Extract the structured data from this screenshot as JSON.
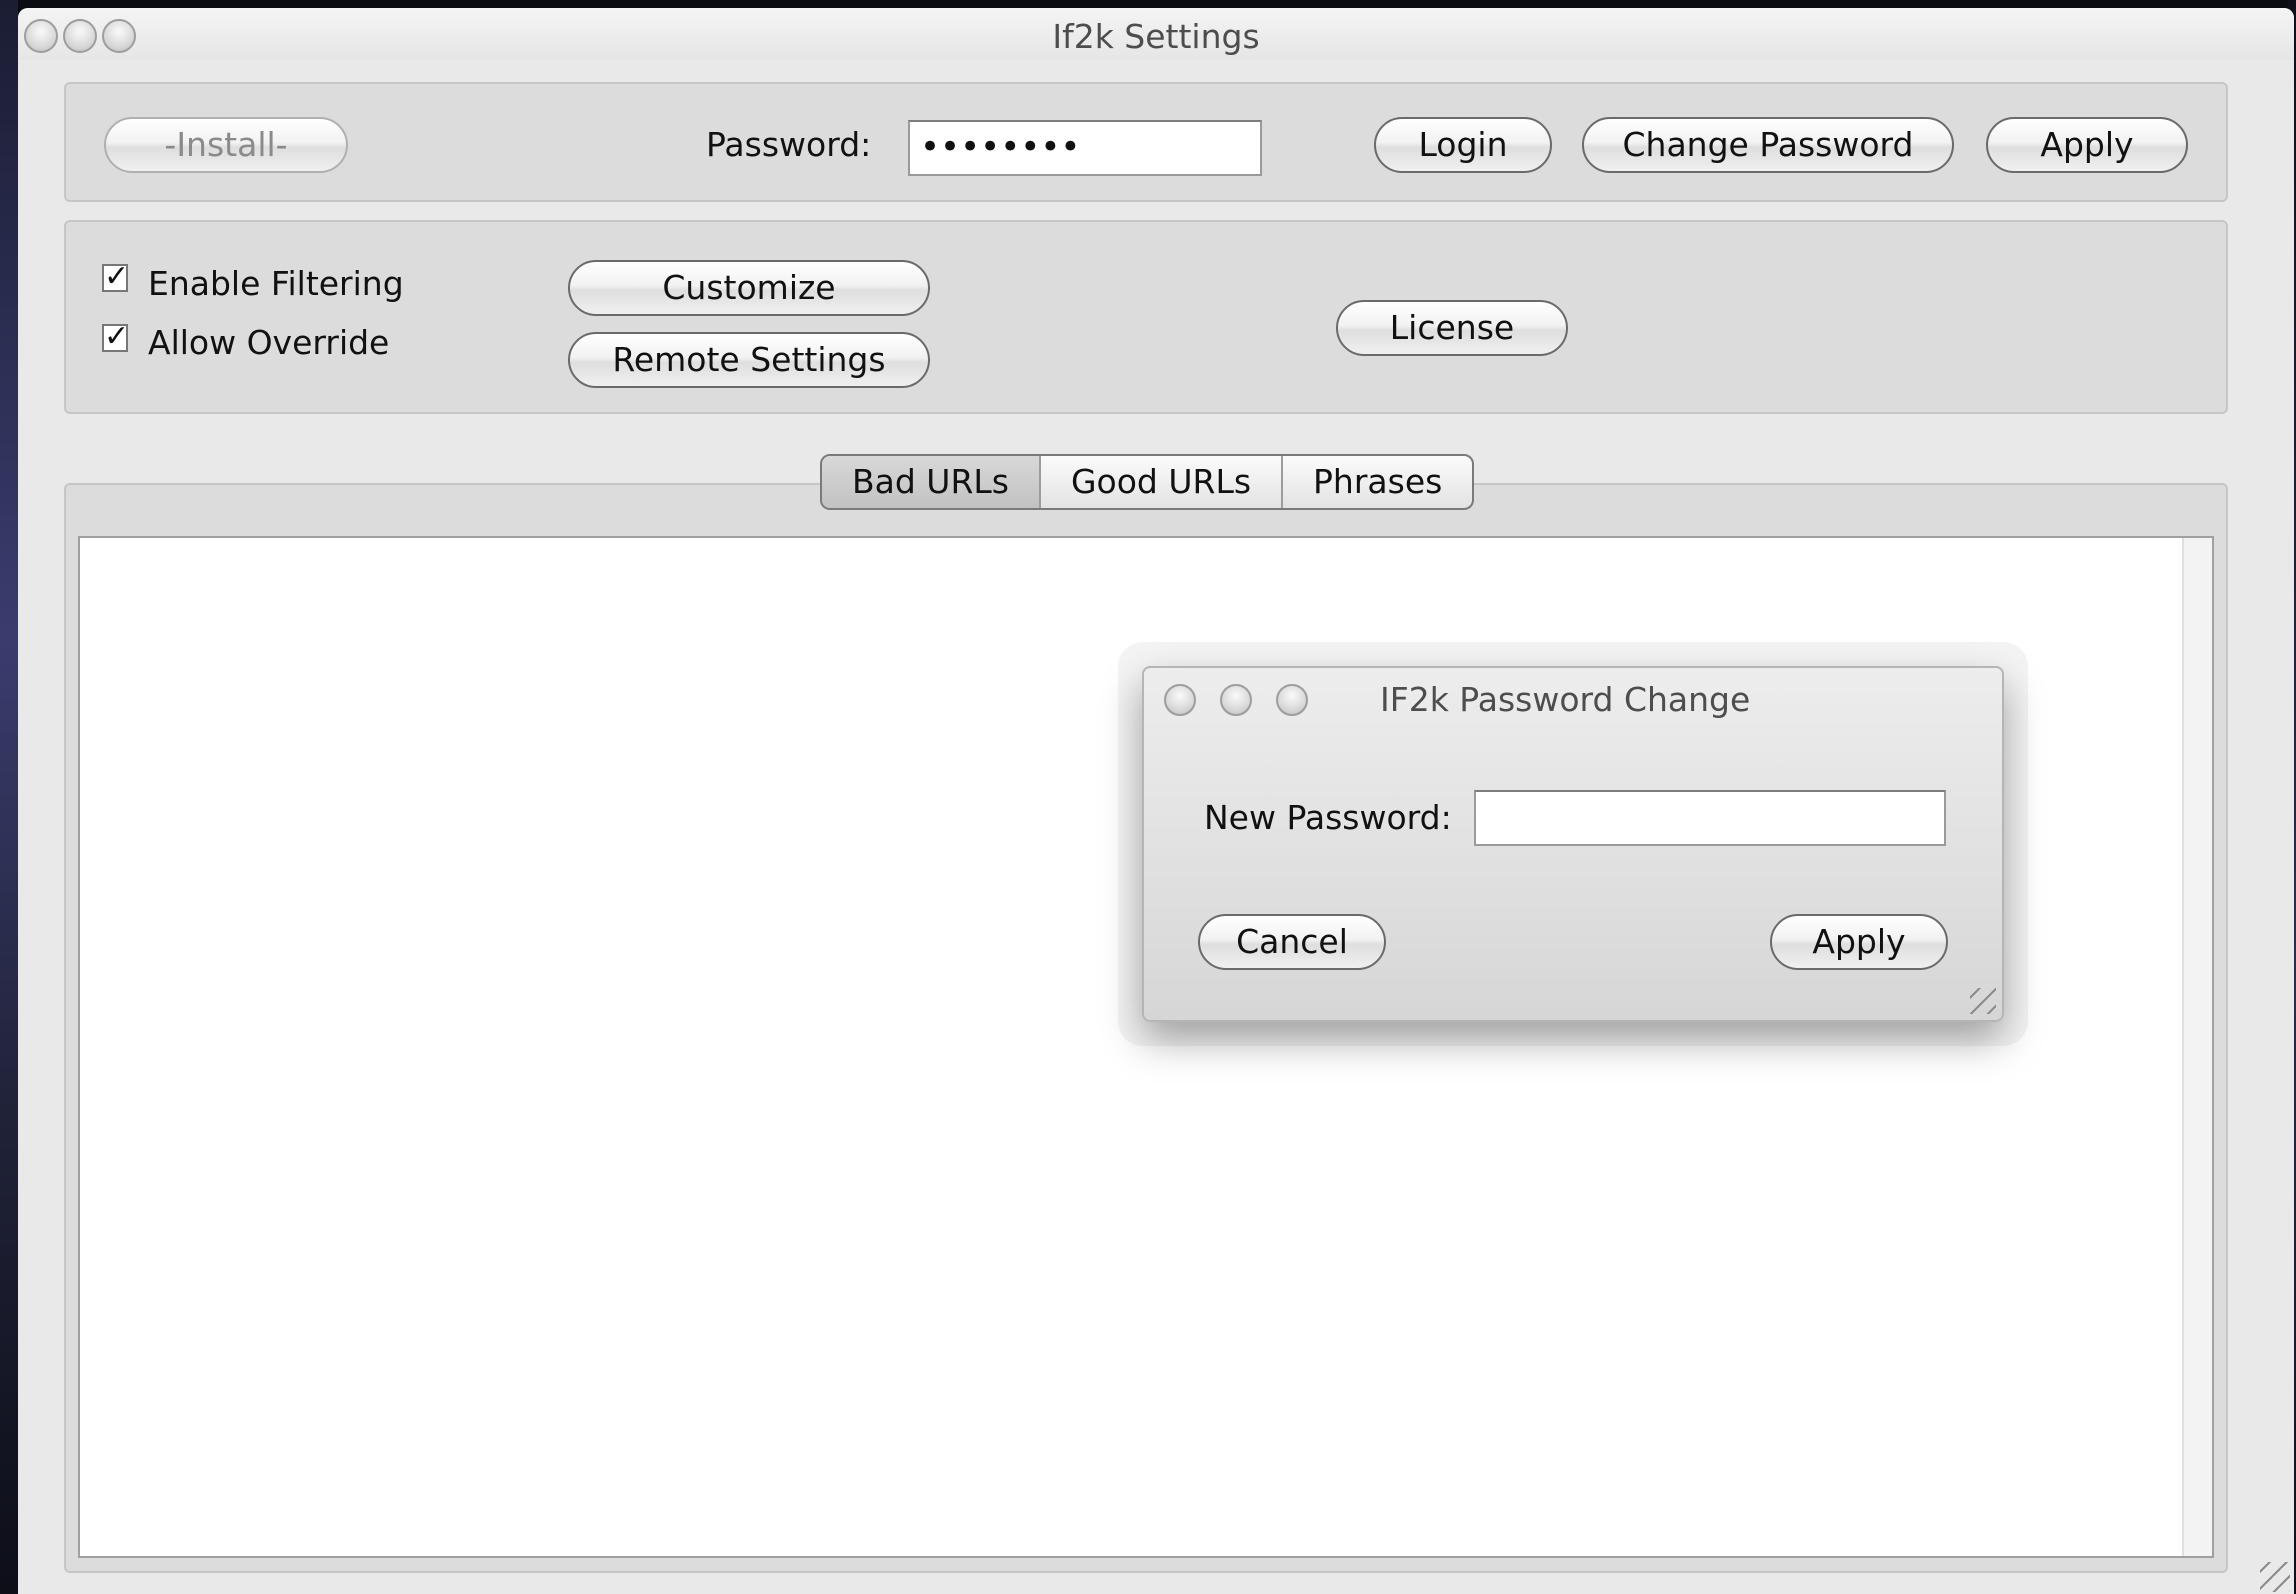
{
  "window": {
    "title": "If2k Settings"
  },
  "toolbar": {
    "install_label": "-Install-",
    "password_label": "Password:",
    "password_value": "••••••••",
    "login_label": "Login",
    "change_password_label": "Change Password",
    "apply_label": "Apply"
  },
  "options": {
    "enable_filtering": {
      "label": "Enable Filtering",
      "checked": true
    },
    "allow_override": {
      "label": "Allow Override",
      "checked": true
    },
    "customize_label": "Customize",
    "remote_settings_label": "Remote Settings",
    "license_label": "License",
    "check_glyph": "✓"
  },
  "tabs": [
    {
      "label": "Bad URLs",
      "active": true
    },
    {
      "label": "Good URLs",
      "active": false
    },
    {
      "label": "Phrases",
      "active": false
    }
  ],
  "dialog": {
    "title": "IF2k Password Change",
    "new_password_label": "New Password:",
    "new_password_value": "",
    "cancel_label": "Cancel",
    "apply_label": "Apply"
  }
}
